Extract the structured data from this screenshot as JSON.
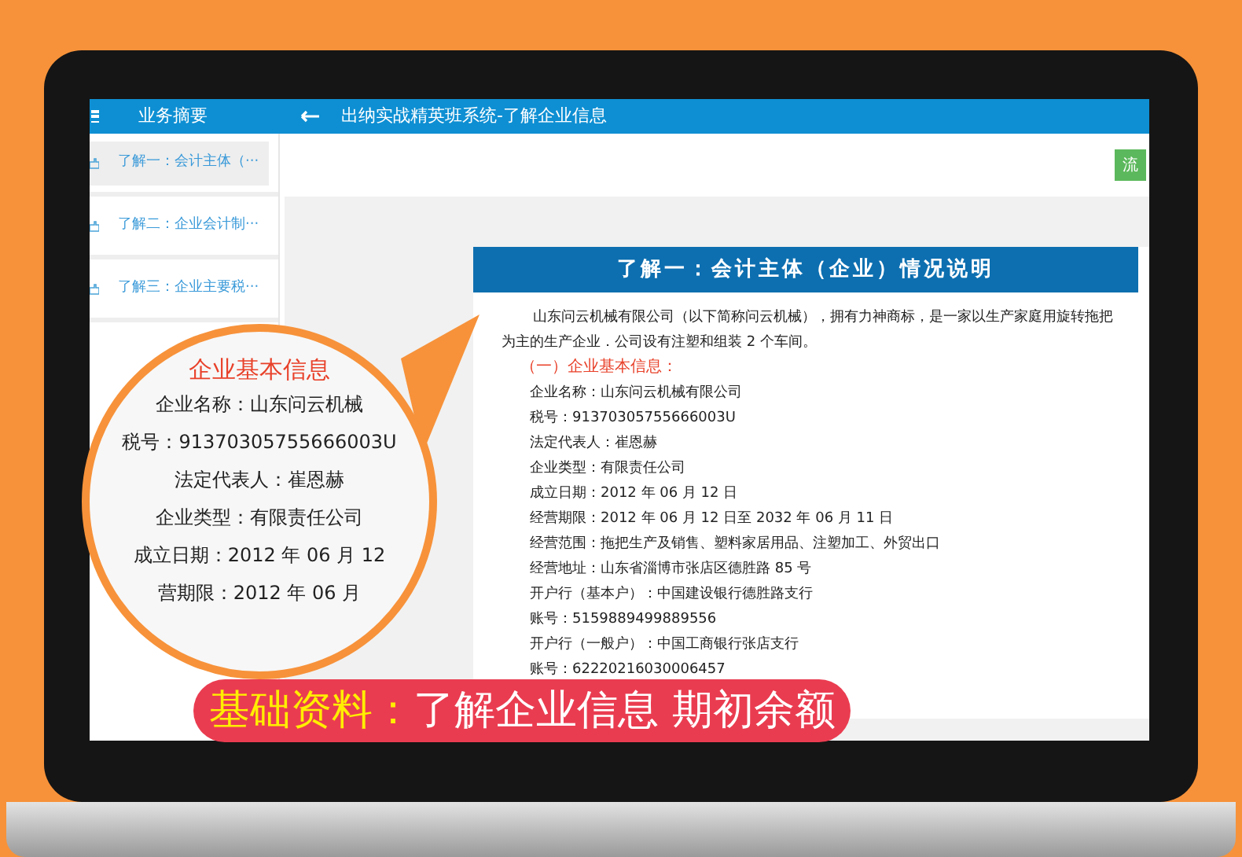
{
  "sidebar": {
    "title": "业务摘要",
    "items": [
      {
        "label": "了解一：会计主体（···",
        "selected": true
      },
      {
        "label": "了解二：企业会计制···",
        "selected": false
      },
      {
        "label": "了解三：企业主要税···",
        "selected": false
      }
    ]
  },
  "header": {
    "title": "出纳实战精英班系统-了解企业信息"
  },
  "toolbar": {
    "button": "流"
  },
  "document": {
    "title": "了解一：会计主体（企业）情况说明",
    "intro": "山东问云机械有限公司（以下简称问云机械），拥有力神商标，是一家以生产家庭用旋转拖把为主的生产企业．公司设有注塑和组装 2 个车间。",
    "section": "（一）企业基本信息：",
    "fields": [
      "企业名称：山东问云机械有限公司",
      "税号：91370305755666003U",
      "法定代表人：崔恩赫",
      "企业类型：有限责任公司",
      "成立日期：2012 年 06 月 12 日",
      "经营期限：2012 年 06 月 12 日至 2032 年 06 月 11 日",
      "经营范围：拖把生产及销售、塑料家居用品、注塑加工、外贸出口",
      "经营地址：山东省淄博市张店区德胜路 85 号",
      "开户行（基本户）：中国建设银行德胜路支行",
      "账号：5159889499889556",
      "开户行（一般户）：中国工商银行张店支行",
      "账号：62220216030006457"
    ]
  },
  "magnifier": {
    "heading": "企业基本信息",
    "lines": [
      "企业名称：山东问云机械",
      "税号：91370305755666003U",
      "法定代表人：崔恩赫",
      "企业类型：有限责任公司",
      "成立日期：2012 年 06 月 12",
      "营期限：2012 年 06 月"
    ]
  },
  "banner": {
    "label": "基础资料：",
    "text": "了解企业信息 期初余额"
  }
}
